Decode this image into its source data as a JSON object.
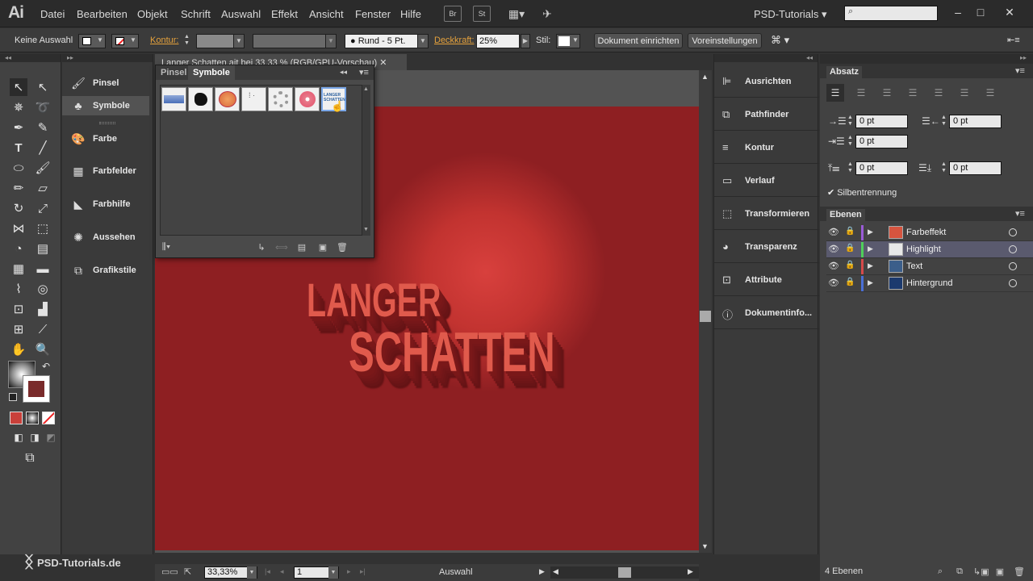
{
  "app": {
    "logo": "Ai",
    "workspace": "PSD-Tutorials"
  },
  "menu": [
    "Datei",
    "Bearbeiten",
    "Objekt",
    "Schrift",
    "Auswahl",
    "Effekt",
    "Ansicht",
    "Fenster",
    "Hilfe"
  ],
  "menubar_buttons": [
    "Br",
    "St"
  ],
  "window_controls": [
    "minimize",
    "maximize",
    "close"
  ],
  "controlbar": {
    "selection": "Keine Auswahl",
    "stroke_label": "Kontur:",
    "brush": "Rund - 5 Pt.",
    "opacity_label": "Deckkraft:",
    "opacity_value": "25%",
    "style_label": "Stil:",
    "btn_doc_setup": "Dokument einrichten",
    "btn_prefs": "Voreinstellungen"
  },
  "left_dock": [
    "Pinsel",
    "Symbole",
    "Farbe",
    "Farbfelder",
    "Farbhilfe",
    "Aussehen",
    "Grafikstile"
  ],
  "document": {
    "tab_title": "Langer Schatten.ait bei 33,33 % (RGB/GPU-Vorschau)",
    "art_line1": "LANGER",
    "art_line2": "SCHATTEN",
    "zoom": "33,33%",
    "page": "1",
    "status": "Auswahl"
  },
  "symbols_panel": {
    "tabs": [
      "Pinsel",
      "Symbole"
    ],
    "selected_tab": "Symbole",
    "selected_symbol_text": "LANGER SCHATTEN"
  },
  "right_dock": [
    "Ausrichten",
    "Pathfinder",
    "Kontur",
    "Verlauf",
    "Transformieren",
    "Transparenz",
    "Attribute",
    "Dokumentinfo..."
  ],
  "paragraph_panel": {
    "title": "Absatz",
    "indent_left": "0 pt",
    "indent_right": "0 pt",
    "indent_first": "0 pt",
    "space_before": "0 pt",
    "space_after": "0 pt",
    "hyphenation": "Silbentrennung"
  },
  "layers_panel": {
    "title": "Ebenen",
    "layers": [
      {
        "name": "Farbeffekt",
        "color": "#9a5bd6",
        "thumb": "#d6543f"
      },
      {
        "name": "Highlight",
        "color": "#4fcf5a",
        "thumb": "#e8e8e8"
      },
      {
        "name": "Text",
        "color": "#d64a4a",
        "thumb": "#3b5e8a"
      },
      {
        "name": "Hintergrund",
        "color": "#4a6fd6",
        "thumb": "#1c3a6e"
      }
    ],
    "count": "4 Ebenen"
  },
  "watermark": "PSD-Tutorials.de",
  "colors": {
    "artboard": "#8e1f22",
    "art_text": "#e05a4c",
    "orange_label": "#e6a23c"
  }
}
